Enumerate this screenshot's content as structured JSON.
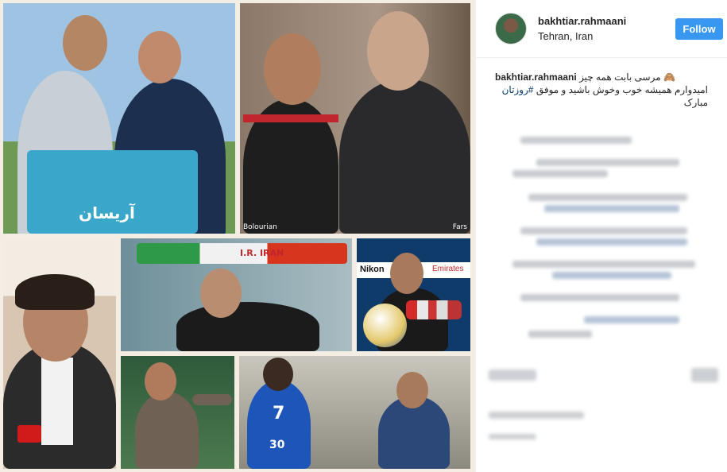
{
  "post": {
    "username": "bakhtiar.rahmaani",
    "location": "Tehran, Iran",
    "follow_label": "Follow",
    "caption_line1": "مرسی بابت همه چیز 🙈",
    "caption_line2_pre": "امیدوارم همیشه خوب وخوش باشید و موفق ",
    "caption_hashtag": "#روزتان",
    "caption_line3": "مبارک"
  },
  "media": {
    "jersey_text": "آریسان",
    "caption_bolourian": "Bolourian",
    "caption_fars": "Fars",
    "banner_text": "I.R. IRAN",
    "sponsor_nikon": "Nikon",
    "sponsor_emirates": "Emirates",
    "shirt_number": "7",
    "shirt_number_2": "30"
  },
  "colors": {
    "follow_button": "#3897f0",
    "hashtag": "#003569",
    "text": "#262626"
  }
}
